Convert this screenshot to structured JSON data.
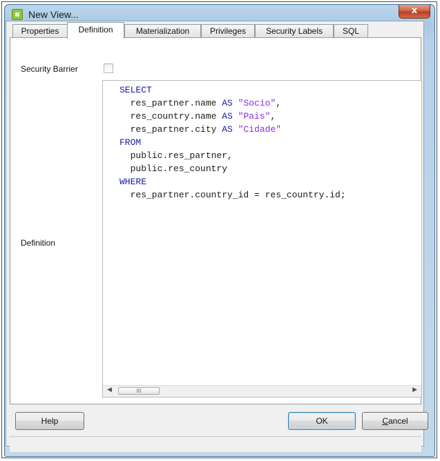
{
  "window": {
    "title": "New View...",
    "close_label": "x"
  },
  "tabs": [
    {
      "label": "Properties"
    },
    {
      "label": "Definition"
    },
    {
      "label": "Materialization"
    },
    {
      "label": "Privileges"
    },
    {
      "label": "Security Labels"
    },
    {
      "label": "SQL"
    }
  ],
  "active_tab": "Definition",
  "form": {
    "security_barrier_label": "Security Barrier",
    "security_barrier_checked": false,
    "definition_label": "Definition"
  },
  "editor": {
    "lines": [
      {
        "kw": "SELECT"
      },
      {
        "text": "  res_partner.name ",
        "kw": "AS",
        "str": "\"Socio\"",
        "tail": ","
      },
      {
        "text": "  res_country.name ",
        "kw": "AS",
        "str": "\"Pais\"",
        "tail": ","
      },
      {
        "text": "  res_partner.city ",
        "kw": "AS",
        "str": "\"Cidade\"",
        "tail": ""
      },
      {
        "kw": "FROM"
      },
      {
        "text": "  public.res_partner,"
      },
      {
        "text": "  public.res_country"
      },
      {
        "kw": "WHERE"
      },
      {
        "text": "  res_partner.country_id = res_country.id;"
      }
    ],
    "scroll_left_icon": "arrow-left",
    "scroll_right_icon": "arrow-right",
    "thumb_grip": "III"
  },
  "buttons": {
    "help": "Help",
    "ok": "OK",
    "cancel": "Cancel"
  },
  "colors": {
    "keyword": "#1919a6",
    "string": "#8a2be2",
    "titlebar": "#a9c8e3",
    "close": "#c84a2c"
  }
}
